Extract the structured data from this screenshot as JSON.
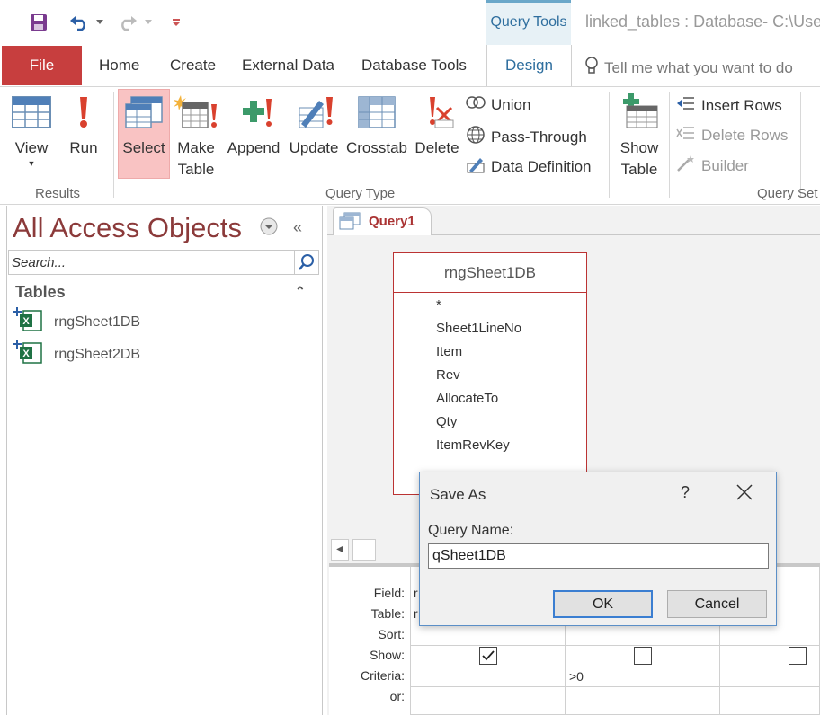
{
  "title_bar": {
    "context_tab": "Query Tools",
    "window_title": "linked_tables : Database- C:\\Users"
  },
  "tabs": {
    "file": "File",
    "home": "Home",
    "create": "Create",
    "external_data": "External Data",
    "database_tools": "Database Tools",
    "design": "Design",
    "tell_me": "Tell me what you want to do"
  },
  "ribbon": {
    "results": {
      "label": "Results",
      "view": "View",
      "run": "Run"
    },
    "query_type": {
      "label": "Query Type",
      "select": "Select",
      "make_table_1": "Make",
      "make_table_2": "Table",
      "append": "Append",
      "update": "Update",
      "crosstab": "Crosstab",
      "delete": "Delete",
      "union": "Union",
      "pass_through": "Pass-Through",
      "data_definition": "Data Definition"
    },
    "query_setup": {
      "label": "Query Set",
      "show_table_1": "Show",
      "show_table_2": "Table",
      "insert_rows": "Insert Rows",
      "delete_rows": "Delete Rows",
      "builder": "Builder"
    }
  },
  "nav": {
    "title": "All Access Objects",
    "search_placeholder": "Search...",
    "section": "Tables",
    "items": [
      {
        "label": "rngSheet1DB"
      },
      {
        "label": "rngSheet2DB"
      }
    ]
  },
  "document": {
    "tab_label": "Query1",
    "field_list": {
      "title": "rngSheet1DB",
      "fields": [
        "*",
        "Sheet1LineNo",
        "Item",
        "Rev",
        "AllocateTo",
        "Qty",
        "ItemRevKey"
      ]
    },
    "grid": {
      "row_labels": [
        "Field:",
        "Table:",
        "Sort:",
        "Show:",
        "Criteria:",
        "or:"
      ],
      "col1_field": "r",
      "col1_table": "r",
      "col2_criteria": ">0"
    }
  },
  "dialog": {
    "title": "Save As",
    "help": "?",
    "label": "Query Name:",
    "value": "qSheet1DB",
    "ok": "OK",
    "cancel": "Cancel"
  },
  "colors": {
    "file_tab": "#c73e3e",
    "accent_blue": "#2e6e9e",
    "access_red": "#8b3a3a",
    "select_highlight": "#f9c3c3"
  }
}
